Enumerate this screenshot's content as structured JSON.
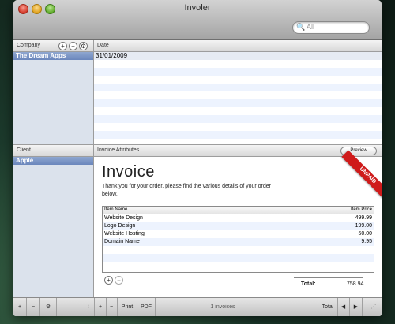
{
  "window": {
    "title": "Involer"
  },
  "search": {
    "placeholder": "All"
  },
  "company_panel": {
    "header": "Company",
    "buttons": [
      "+",
      "−",
      "⚙"
    ],
    "selected": "The Dream Apps"
  },
  "date_panel": {
    "header": "Date",
    "rows": [
      "31/01/2009"
    ]
  },
  "client_panel": {
    "header": "Client",
    "selected": "Apple"
  },
  "invoice_panel": {
    "header": "Invoice Attributes",
    "preview_label": "Preview",
    "title": "Invoice",
    "description": "Thank you for your order, please find the various details of your order below.",
    "status_ribbon": "UNPAID",
    "columns": [
      "Item Name",
      "Item Price"
    ],
    "items": [
      {
        "name": "Website Design",
        "price": "499.99"
      },
      {
        "name": "Logo Design",
        "price": "199.00"
      },
      {
        "name": "Website Hosting",
        "price": "50.00"
      },
      {
        "name": "Domain Name",
        "price": "9.95"
      }
    ],
    "total_label": "Total:",
    "total_value": "758.94"
  },
  "bottom_bar": {
    "left_buttons": [
      "+",
      "−",
      "⚙"
    ],
    "right_buttons": [
      "+",
      "−",
      "Print",
      "PDF"
    ],
    "count_label": "1 invoices",
    "total_button": "Total",
    "nav_prev": "◀",
    "nav_next": "▶"
  },
  "colors": {
    "selection": "#7890c4",
    "ribbon": "#cf1a1a",
    "row_alt": "#edf3fe"
  }
}
